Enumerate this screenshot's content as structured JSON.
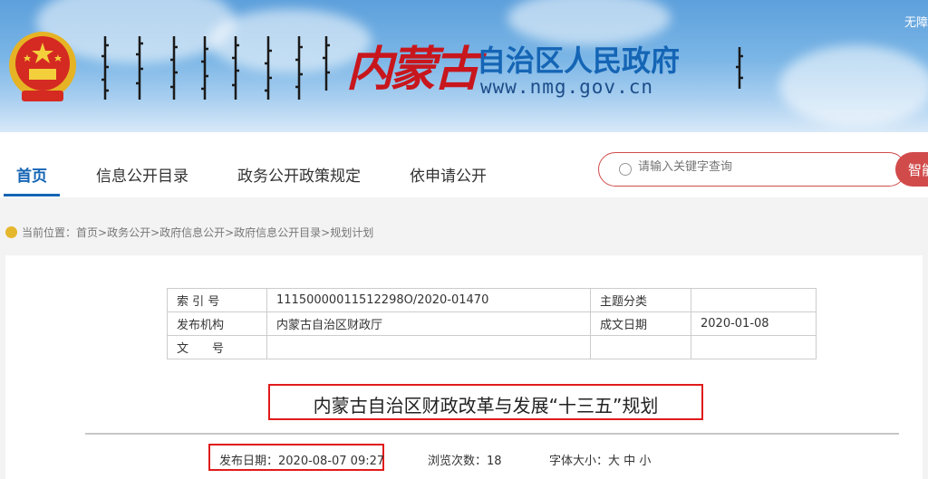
{
  "header": {
    "brand_logo_text": "内蒙古",
    "brand_title": "自治区人民政府",
    "brand_url": "www.nmg.gov.cn",
    "top_right_text": "无障"
  },
  "nav": {
    "items": [
      {
        "label": "首页",
        "active": true
      },
      {
        "label": "信息公开目录"
      },
      {
        "label": "政务公开政策规定"
      },
      {
        "label": "依申请公开"
      }
    ]
  },
  "search": {
    "placeholder": "请输入关键字查询",
    "button_label": "智能"
  },
  "breadcrumb": {
    "prefix": "当前位置：",
    "path": "首页>政务公开>政府信息公开>政府信息公开目录>规划计划"
  },
  "meta_table": {
    "index_label": "索 引 号",
    "index_value": "11150000011512298O/2020-01470",
    "topic_label": "主题分类",
    "topic_value": "",
    "org_label": "发布机构",
    "org_value": "内蒙古自治区财政厅",
    "date_label": "成文日期",
    "date_value": "2020-01-08",
    "doc_label": "文　　号",
    "doc_value": ""
  },
  "article": {
    "title": "内蒙古自治区财政改革与发展“十三五”规划",
    "publish_date": "发布日期：2020-08-07 09:27",
    "views": "浏览次数：18",
    "font_size_label": "字体大小：",
    "font_sizes": [
      "大",
      "中",
      "小"
    ]
  },
  "colors": {
    "brand_red": "#c8161d",
    "brand_blue": "#1565b5",
    "highlight_red": "#e01b1b"
  }
}
